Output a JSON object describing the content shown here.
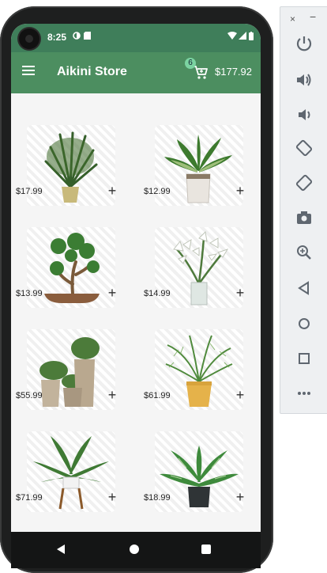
{
  "status": {
    "time": "8:25"
  },
  "appbar": {
    "title": "Aikini Store",
    "cart_count": "6",
    "total": "$177.92"
  },
  "products": [
    {
      "price": "$17.99",
      "plant": "palm in gold pot"
    },
    {
      "price": "$12.99",
      "plant": "dracaena in white pot"
    },
    {
      "price": "$13.99",
      "plant": "bonsai jade"
    },
    {
      "price": "$14.99",
      "plant": "lily in vase"
    },
    {
      "price": "$55.99",
      "plant": "plant trio in tall pots"
    },
    {
      "price": "$61.99",
      "plant": "parlor palm in yellow pot"
    },
    {
      "price": "$71.99",
      "plant": "calathea on stand"
    },
    {
      "price": "$18.99",
      "plant": "aglaonema in black pot"
    }
  ],
  "add_symbol": "+",
  "emulator": {
    "close_symbol": "×",
    "minimize_symbol": "−",
    "buttons": [
      "power-icon",
      "volume-up-icon",
      "volume-down-icon",
      "rotate-left-icon",
      "rotate-right-icon",
      "camera-icon",
      "zoom-icon",
      "back-icon",
      "home-icon",
      "overview-icon",
      "more-icon"
    ]
  }
}
